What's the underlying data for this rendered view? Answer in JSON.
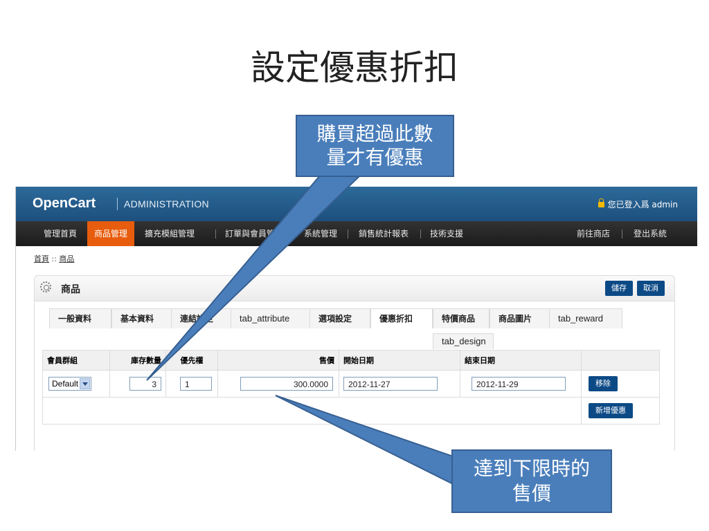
{
  "slide": {
    "title": "設定優惠折扣",
    "callout_top": [
      "購買超過此數",
      "量才有優惠"
    ],
    "callout_bottom": [
      "達到下限時的",
      "售價"
    ]
  },
  "header": {
    "brand": "OpenCart",
    "subtitle": "ADMINISTRATION",
    "login_text": "您已登入爲 admin"
  },
  "menu": {
    "items": [
      "管理首頁",
      "商品管理",
      "擴充模組管理",
      "訂單與會員管理",
      "系統管理",
      "銷售統計報表",
      "技術支援"
    ],
    "active": "商品管理",
    "right": [
      "前往商店",
      "登出系統"
    ]
  },
  "breadcrumb": [
    "首頁",
    "::",
    "商品"
  ],
  "panel": {
    "title": "商品",
    "save": "儲存",
    "cancel": "取消"
  },
  "tabs": [
    "一般資料",
    "基本資料",
    "連結設定",
    "tab_attribute",
    "選項設定",
    "優惠折扣",
    "特價商品",
    "商品圖片",
    "tab_reward",
    "tab_design"
  ],
  "active_tab": "優惠折扣",
  "discount_table": {
    "headers": [
      "會員群組",
      "庫存數量",
      "優先權",
      "售價",
      "開始日期",
      "結束日期"
    ],
    "row": {
      "group": "Default",
      "quantity": "3",
      "priority": "1",
      "price": "300.0000",
      "date_start": "2012-11-27",
      "date_end": "2012-11-29",
      "remove": "移除"
    },
    "add": "新增優惠"
  },
  "colors": {
    "header_blue": "#1d4f7d",
    "menu_active": "#e85c0d",
    "button": "#0c4a86",
    "callout": "#4a7ebb"
  }
}
